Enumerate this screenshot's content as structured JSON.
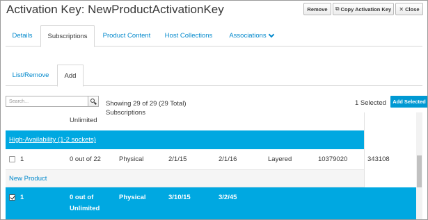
{
  "header": {
    "title": "Activation Key: NewProductActivationKey",
    "remove_label": "Remove",
    "copy_label": "Copy Activation Key",
    "close_label": "Close"
  },
  "tabs": [
    {
      "label": "Details"
    },
    {
      "label": "Subscriptions"
    },
    {
      "label": "Product Content"
    },
    {
      "label": "Host Collections"
    },
    {
      "label": "Associations"
    }
  ],
  "subtabs": [
    {
      "label": "List/Remove"
    },
    {
      "label": "Add"
    }
  ],
  "search": {
    "placeholder": "Search..."
  },
  "summary": {
    "showing": "Showing 29 of 29 (29 Total) Subscriptions",
    "selected": "1 Selected",
    "add_selected_label": "Add Selected"
  },
  "table": {
    "partial_top": "Unlimited",
    "group1": "High-Availability (1-2 sockets)",
    "row1": {
      "qty": "1",
      "attached": "0 out of 22",
      "type": "Physical",
      "start": "2/1/15",
      "end": "2/1/16",
      "support": "Layered",
      "contract": "10379020",
      "account": "343108"
    },
    "group2": "New Product",
    "row2": {
      "qty": "1",
      "attached_line1": "0 out of",
      "attached_line2": "Unlimited",
      "type": "Physical",
      "start": "3/10/15",
      "end": "3/2/45"
    }
  },
  "colors": {
    "accent": "#00a8e1",
    "link": "#0088cc"
  }
}
